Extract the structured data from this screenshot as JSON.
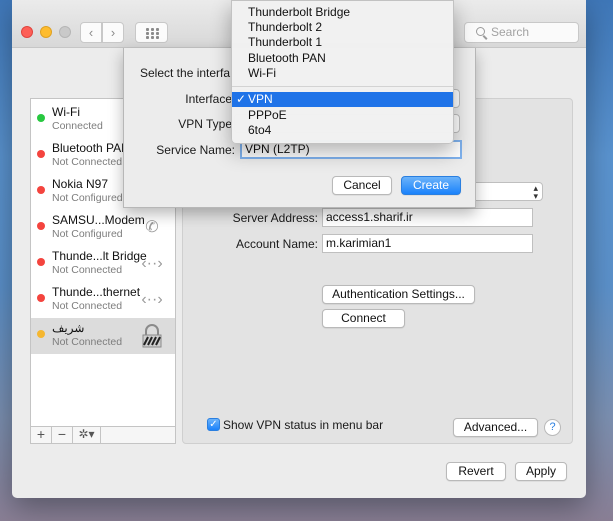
{
  "window": {
    "search_placeholder": "Search",
    "nav_back_glyph": "‹",
    "nav_forward_glyph": "›"
  },
  "sidebar": {
    "services": [
      {
        "name": "Wi-Fi",
        "status": "Connected",
        "dot_color": "#28c840",
        "icon": ""
      },
      {
        "name": "Bluetooth PAN",
        "status": "Not Connected",
        "dot_color": "#f4443e",
        "icon": ""
      },
      {
        "name": "Nokia N97",
        "status": "Not Configured",
        "dot_color": "#f4443e",
        "icon": ""
      },
      {
        "name": "SAMSU...Modem",
        "status": "Not Configured",
        "dot_color": "#f4443e",
        "icon": "phone-icon"
      },
      {
        "name": "Thunde...lt Bridge",
        "status": "Not Connected",
        "dot_color": "#f4443e",
        "icon": "ethernet-icon"
      },
      {
        "name": "Thunde...thernet",
        "status": "Not Connected",
        "dot_color": "#f4443e",
        "icon": "ethernet-icon"
      },
      {
        "name": "شریف",
        "status": "Not Connected",
        "dot_color": "#f5b731",
        "icon": "vpn-lock-icon",
        "selected": true
      }
    ],
    "add_label": "+",
    "remove_label": "−",
    "gear_label": "✲▾"
  },
  "detail": {
    "server_address_label": "Server Address:",
    "server_address_value": "access1.sharif.ir",
    "account_name_label": "Account Name:",
    "account_name_value": "m.karimian1",
    "auth_settings_label": "Authentication Settings...",
    "connect_label": "Connect",
    "show_vpn_status_label": "Show VPN status in menu bar",
    "show_vpn_status_checked": true,
    "advanced_label": "Advanced...",
    "help_label": "?",
    "revert_label": "Revert",
    "apply_label": "Apply"
  },
  "sheet": {
    "prompt": "Select the interfa",
    "interface_label": "Interface",
    "vpn_type_label": "VPN Type",
    "service_name_label": "Service Name:",
    "service_name_value": "VPN (L2TP)",
    "cancel_label": "Cancel",
    "create_label": "Create"
  },
  "interface_menu": {
    "items_top": [
      "Thunderbolt Bridge",
      "Thunderbolt 2",
      "Thunderbolt 1",
      "Bluetooth PAN",
      "Wi-Fi"
    ],
    "items_bottom": [
      "VPN",
      "PPPoE",
      "6to4"
    ],
    "selected": "VPN",
    "check_glyph": "✓"
  }
}
